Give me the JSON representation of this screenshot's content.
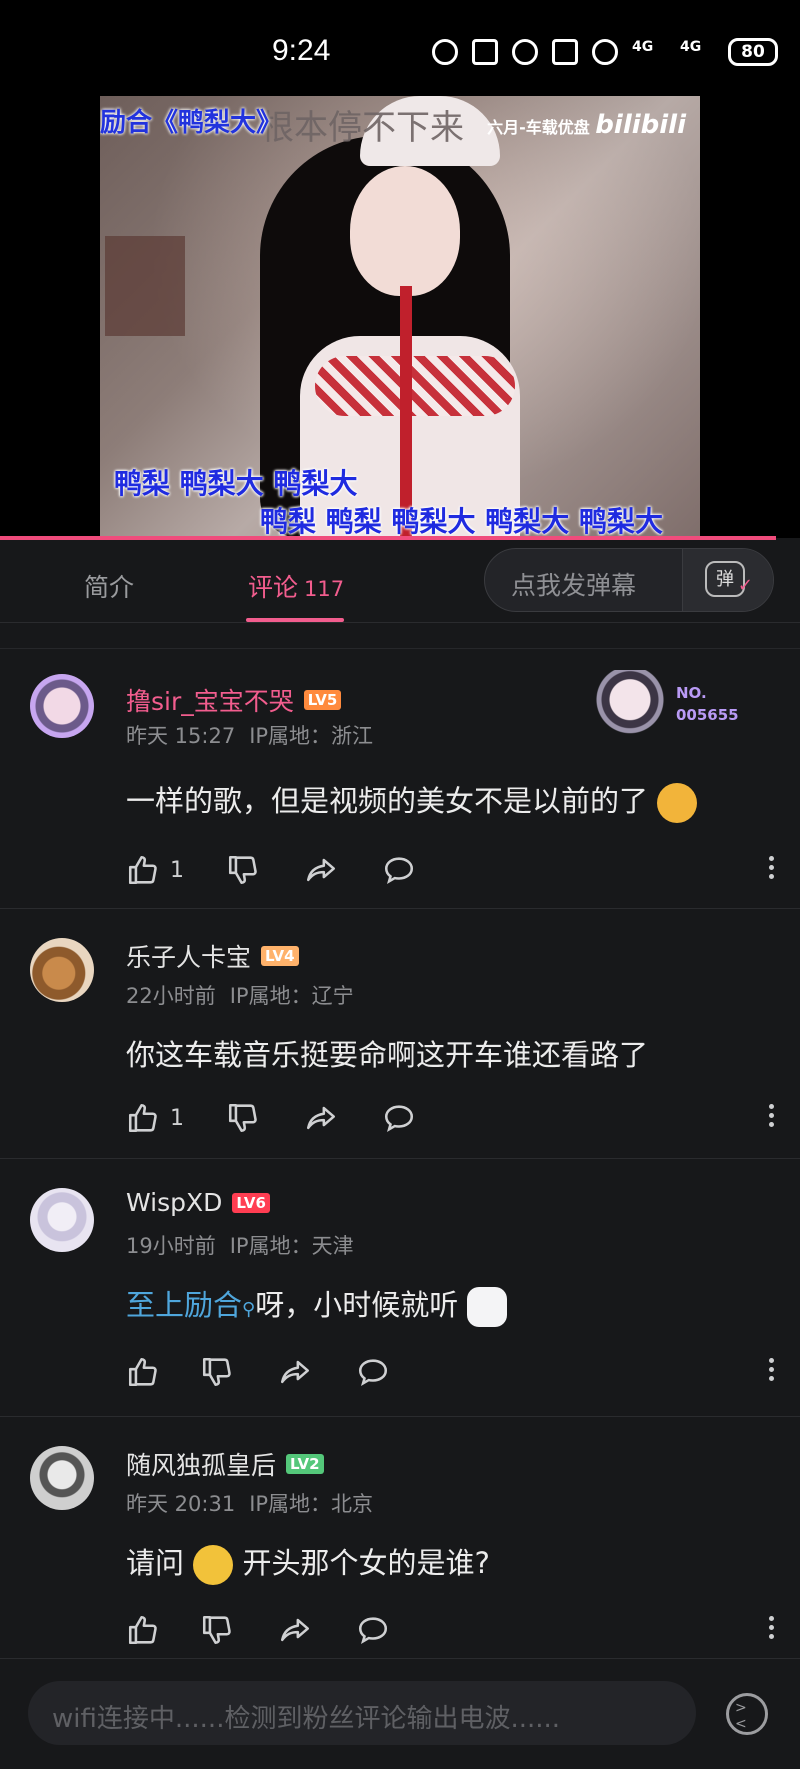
{
  "status_bar": {
    "time": "9:24",
    "network1": "4G",
    "network2": "4G",
    "battery": "80"
  },
  "video": {
    "overlay_title": "励合《鸭梨大》",
    "overlay_subtitle": "根本停不下来",
    "brand_prefix": "六月-车载优盘",
    "brand_logo": "bilibili",
    "lyric_line1": "鸭梨 鸭梨大 鸭梨大",
    "lyric_line2": "鸭梨 鸭梨 鸭梨大 鸭梨大 鸭梨大",
    "progress": 0.97
  },
  "tabs": {
    "intro_label": "简介",
    "comments_label": "评论",
    "comments_count": "117",
    "danmaku_placeholder": "点我发弹幕",
    "danmaku_icon_label": "弹"
  },
  "comments": [
    {
      "username": "撸sir_宝宝不哭",
      "level": "LV5",
      "level_color": "#ff8a3d",
      "time": "昨天 15:27",
      "ip": "IP属地：浙江",
      "text": "一样的歌，但是视频的美女不是以前的了",
      "emoji": "doge-emoji",
      "likes": "1",
      "fan_badge_label": "NO.",
      "fan_badge_number": "005655"
    },
    {
      "username": "乐子人卡宝",
      "level": "LV4",
      "level_color": "#ffb26b",
      "time": "22小时前",
      "ip": "IP属地：辽宁",
      "text": "你这车载音乐挺要命啊这开车谁还看路了",
      "likes": "1"
    },
    {
      "username": "WispXD",
      "level": "LV6",
      "level_color": "#ff3d52",
      "time": "19小时前",
      "ip": "IP属地：天津",
      "mention": "至上励合",
      "text": "呀，小时候就听",
      "emoji": "tv-face-emoji",
      "likes": ""
    },
    {
      "username": "随风独孤皇后",
      "level": "LV2",
      "level_color": "#54c77a",
      "time": "昨天 20:31",
      "ip": "IP属地：北京",
      "text_before": "请问",
      "emoji": "tears-emoji",
      "text_after": "开头那个女的是谁?",
      "likes": ""
    }
  ],
  "bottom": {
    "input_placeholder": "wifi连接中......检测到粉丝评论输出电波......"
  }
}
